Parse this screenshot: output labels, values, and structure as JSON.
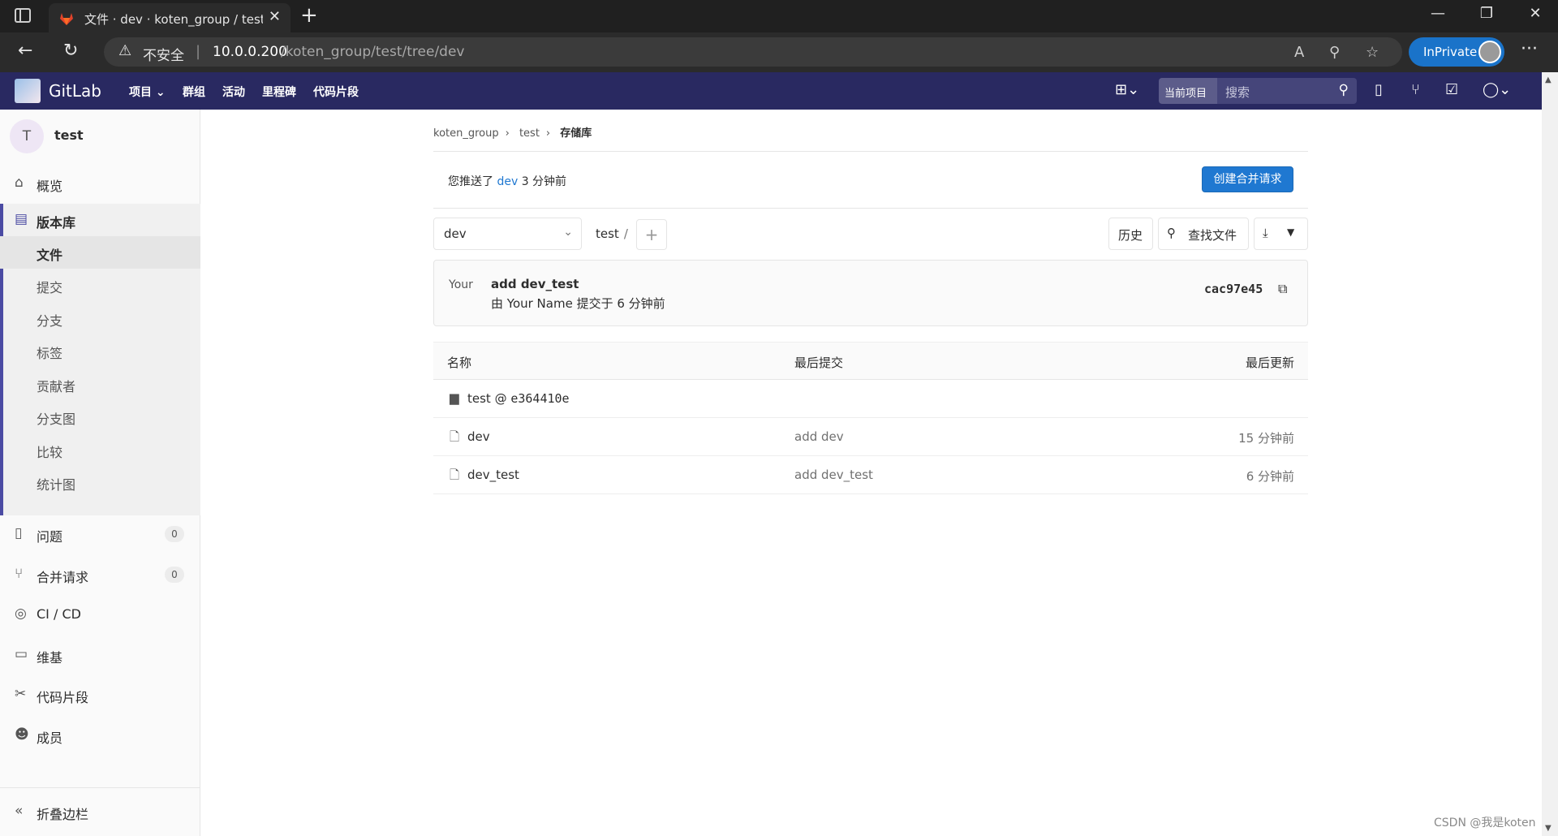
{
  "browser": {
    "tab_title": "文件 · dev · koten_group / test · GitLab",
    "tab_close": "✕",
    "new_tab": "+",
    "url_warning": "不安全",
    "url_separator": "|",
    "url_host": "10.0.0.200",
    "url_path": "/koten_group/test/tree/dev",
    "inprivate_label": "InPrivate",
    "more": "···"
  },
  "gitlab_header": {
    "brand": "GitLab",
    "nav": [
      "项目 ⌄",
      "群组",
      "活动",
      "里程碑",
      "代码片段"
    ],
    "search_scope": "当前项目",
    "search_placeholder": "搜索"
  },
  "sidebar": {
    "project_avatar_letter": "T",
    "project_name": "test",
    "overview": "概览",
    "repository": "版本库",
    "repo_items": [
      "文件",
      "提交",
      "分支",
      "标签",
      "贡献者",
      "分支图",
      "比较",
      "统计图"
    ],
    "issues": "问题",
    "issues_count": "0",
    "merge_requests": "合并请求",
    "merge_requests_count": "0",
    "cicd": "CI / CD",
    "wiki": "维基",
    "snippets": "代码片段",
    "members": "成员",
    "collapse": "折叠边栏"
  },
  "breadcrumb": {
    "group": "koten_group",
    "project": "test",
    "current": "存储库"
  },
  "push_notice": {
    "prefix": "您推送了",
    "branch": "dev",
    "suffix": "3 分钟前",
    "button": "创建合并请求"
  },
  "toolbar": {
    "branch": "dev",
    "path": "test",
    "path_sep": "/",
    "add": "+",
    "history": "历史",
    "find_file": "查找文件"
  },
  "last_commit": {
    "avatar_alt": "Your",
    "title": "add dev_test",
    "meta": "由 Your Name 提交于 6 分钟前",
    "sha": "cac97e45"
  },
  "tree": {
    "headers": {
      "name": "名称",
      "last_commit": "最后提交",
      "last_update": "最后更新"
    },
    "submodule": {
      "name": "test @ ",
      "sha": "e364410e"
    },
    "rows": [
      {
        "name": "dev",
        "commit": "add dev",
        "updated": "15 分钟前"
      },
      {
        "name": "dev_test",
        "commit": "add dev_test",
        "updated": "6 分钟前"
      }
    ]
  },
  "watermark": "CSDN @我是koten"
}
